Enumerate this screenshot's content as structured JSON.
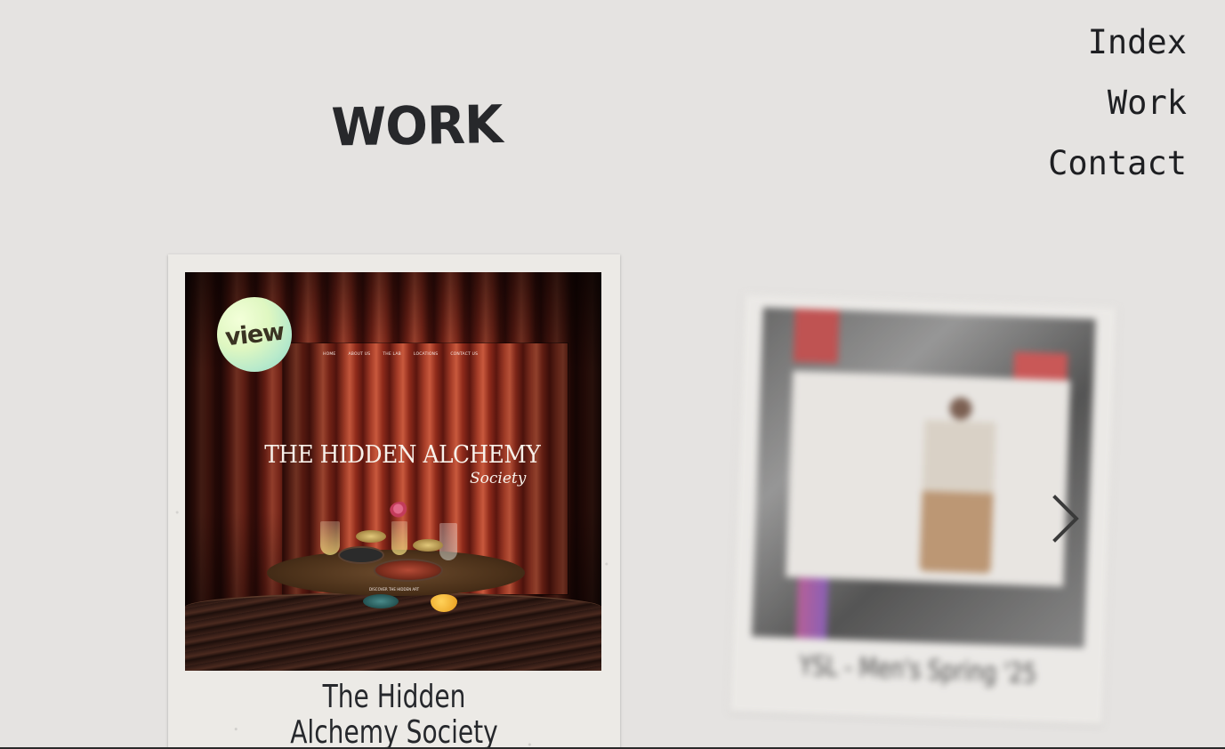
{
  "header": {
    "title": "WORK"
  },
  "nav": {
    "items": [
      {
        "label": "Index"
      },
      {
        "label": "Work"
      },
      {
        "label": "Contact"
      }
    ]
  },
  "projects": [
    {
      "caption_line1": "The Hidden",
      "caption_line2": "Alchemy Society",
      "view_label": "view",
      "screenshot": {
        "nav": [
          "HOME",
          "ABOUT US",
          "THE LAB",
          "LOCATIONS",
          "CONTACT US"
        ],
        "title": "THE HIDDEN ALCHEMY",
        "subtitle": "Society",
        "cta": "DISCOVER THE HIDDEN ART"
      }
    },
    {
      "caption": "YSL - Men's Spring '25"
    }
  ],
  "carousel": {
    "next_icon": "chevron-right-icon"
  },
  "colors": {
    "background": "#e5e3e1",
    "text": "#1e1f22",
    "card": "#eceae6",
    "view_badge": "#dff7c1"
  }
}
